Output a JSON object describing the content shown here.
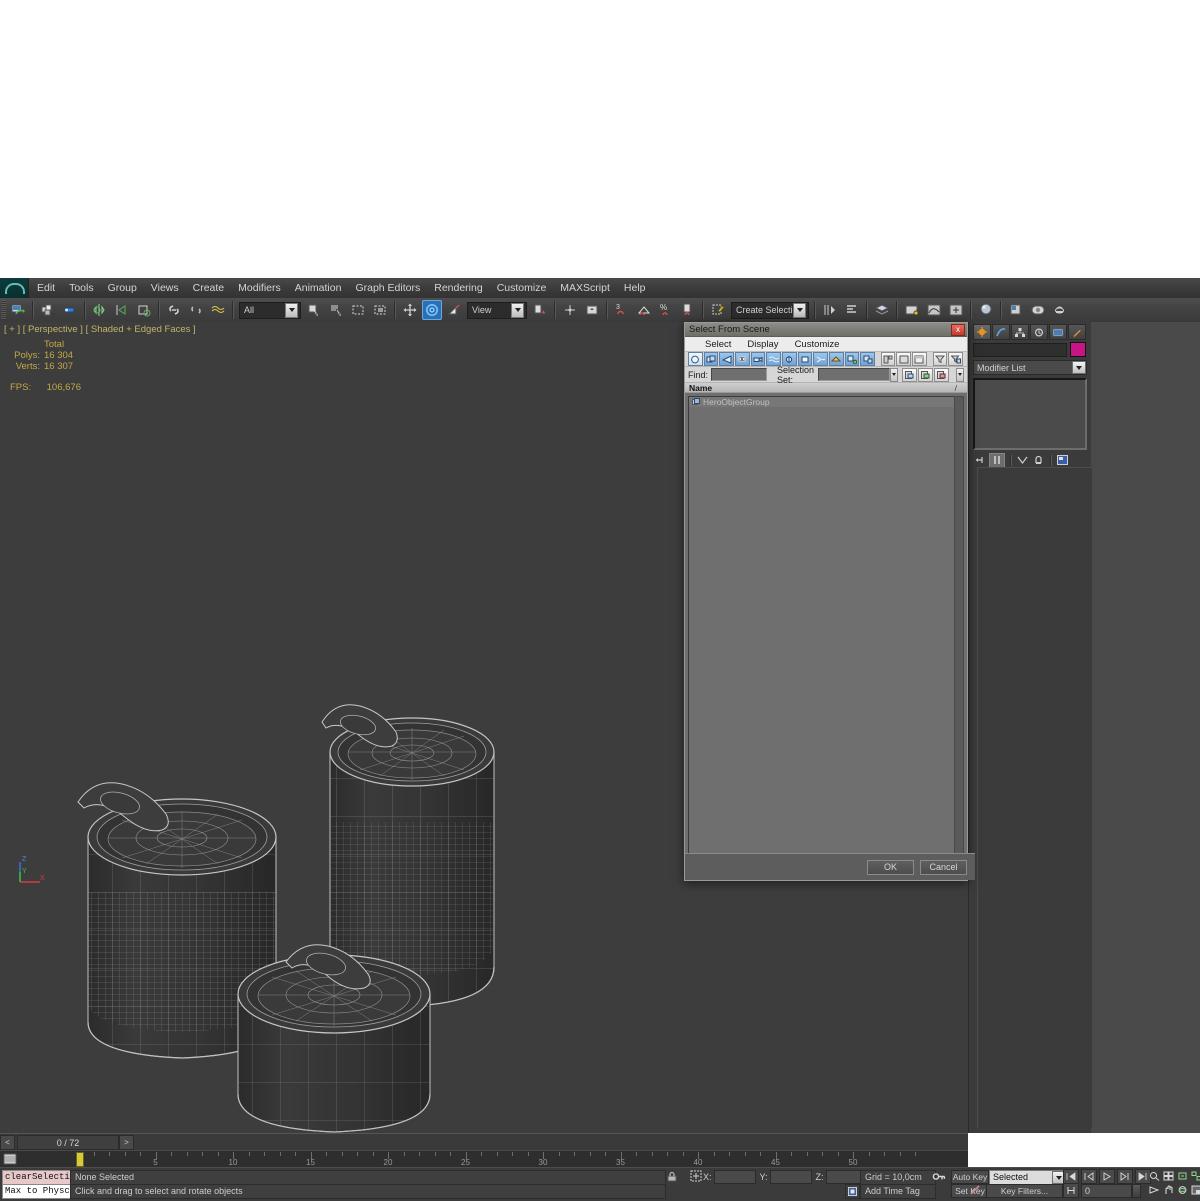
{
  "app": {
    "menu": [
      "Edit",
      "Tools",
      "Group",
      "Views",
      "Create",
      "Modifiers",
      "Animation",
      "Graph Editors",
      "Rendering",
      "Customize",
      "MAXScript",
      "Help"
    ],
    "logo_name": "3ds-max-logo"
  },
  "toolbar": {
    "selection_filter": "All",
    "reference_coord": "View",
    "named_selection_set": "Create Selection Se"
  },
  "viewport": {
    "label": "[ + ] [ Perspective ] [ Shaded + Edged Faces ]",
    "stats_header": "Total",
    "polys_label": "Polys:",
    "polys_value": "16 304",
    "verts_label": "Verts:",
    "verts_value": "16 307",
    "fps_label": "FPS:",
    "fps_value": "106,676",
    "axis": {
      "x": "X",
      "y": "Y",
      "z": "Z"
    }
  },
  "command_panel": {
    "tabs": [
      "create-tab",
      "modify-tab",
      "hierarchy-tab",
      "motion-tab",
      "display-tab",
      "utilities-tab"
    ],
    "object_name": "",
    "object_color": "#c71585",
    "modifier_list_label": "Modifier List"
  },
  "dialog": {
    "title": "Select From Scene",
    "close_label": "x",
    "menu": [
      "Select",
      "Display",
      "Customize"
    ],
    "toolbar_icons": [
      "display-all-icon",
      "display-geometry-icon",
      "display-shapes-icon",
      "display-lights-icon",
      "display-cameras-icon",
      "display-helpers-icon",
      "display-space-warps-icon",
      "display-groups-icon",
      "display-xrefs-icon",
      "display-bones-icon",
      "display-children-icon",
      "display-influences-icon",
      "expand-all-icon",
      "collapse-all-icon",
      "expand-selected-icon",
      "filter-icon",
      "filter-selected-icon"
    ],
    "find_label": "Find:",
    "find_value": "",
    "selection_set_label": "Selection Set:",
    "selection_set_value": "",
    "column_header": "Name",
    "items": [
      {
        "name": "HeroObjectGroup",
        "icon": "group-icon"
      }
    ],
    "ok_label": "OK",
    "cancel_label": "Cancel"
  },
  "timeline": {
    "current_frame": "0 / 72",
    "prev_label": "<",
    "next_label": ">",
    "ticks": [
      "5",
      "10",
      "15",
      "20",
      "25",
      "30",
      "35",
      "40",
      "45",
      "50"
    ]
  },
  "status": {
    "maxscript_line1": "clearSelectio",
    "maxscript_line2": "Max to Physca",
    "selection_text": "None Selected",
    "prompt_text": "Click and drag to select and rotate objects",
    "coords": [
      {
        "label": "X:",
        "value": ""
      },
      {
        "label": "Y:",
        "value": ""
      },
      {
        "label": "Z:",
        "value": ""
      }
    ],
    "grid_label": "Grid = 10,0cm",
    "add_time_tag": "Add Time Tag",
    "auto_key": "Auto Key",
    "set_key": "Set Key",
    "key_mode_selected": "Selected",
    "key_filters": "Key Filters...",
    "frame_field": "0"
  }
}
